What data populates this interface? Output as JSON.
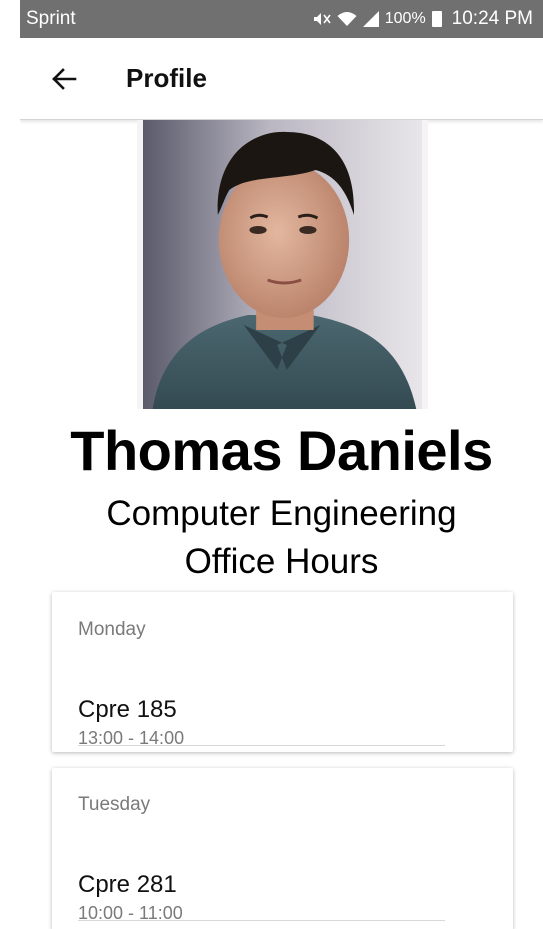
{
  "status_bar": {
    "carrier": "Sprint",
    "battery": "100%",
    "time": "10:24 PM",
    "icons": [
      "mute-icon",
      "wifi-icon",
      "signal-icon",
      "battery-icon"
    ]
  },
  "app_bar": {
    "title": "Profile",
    "back_icon": "arrow-left-icon"
  },
  "profile": {
    "name": "Thomas Daniels",
    "department": "Computer Engineering",
    "section_title": "Office Hours"
  },
  "office_hours": [
    {
      "day": "Monday",
      "course": "Cpre 185",
      "time": "13:00 - 14:00"
    },
    {
      "day": "Tuesday",
      "course": "Cpre 281",
      "time": "10:00 - 11:00"
    }
  ],
  "colors": {
    "status_bar": "#707070",
    "app_bar": "#ffffff",
    "secondary_text": "#7a7a7a"
  }
}
